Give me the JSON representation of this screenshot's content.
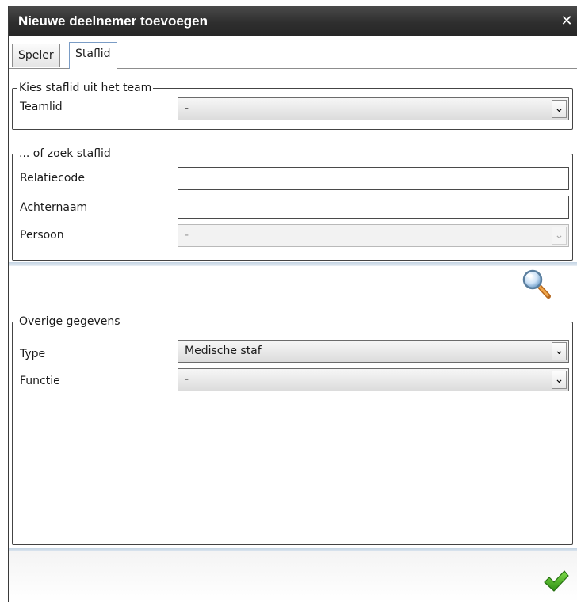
{
  "dialog": {
    "title": "Nieuwe deelnemer toevoegen",
    "close_glyph": "✕"
  },
  "tabs": [
    {
      "label": "Speler",
      "active": false
    },
    {
      "label": "Staflid",
      "active": true
    }
  ],
  "group_team": {
    "legend": "Kies staflid uit het team",
    "teamlid": {
      "label": "Teamlid",
      "value": "-"
    }
  },
  "group_search": {
    "legend": "... of zoek staflid",
    "relatiecode": {
      "label": "Relatiecode",
      "value": ""
    },
    "achternaam": {
      "label": "Achternaam",
      "value": ""
    },
    "persoon": {
      "label": "Persoon",
      "value": "-",
      "disabled": true
    }
  },
  "group_other": {
    "legend": "Overige gegevens",
    "type": {
      "label": "Type",
      "value": "Medische staf"
    },
    "functie": {
      "label": "Functie",
      "value": "-"
    }
  },
  "icons": {
    "search": "magnifier-icon",
    "confirm": "checkmark-icon",
    "dropdown": "chevron-down-icon"
  },
  "colors": {
    "titlebar": "#2e2e2e",
    "tab_active_border": "#7a9cc5",
    "confirm_green": "#3aa51a",
    "separator": "#c3d3e3"
  }
}
